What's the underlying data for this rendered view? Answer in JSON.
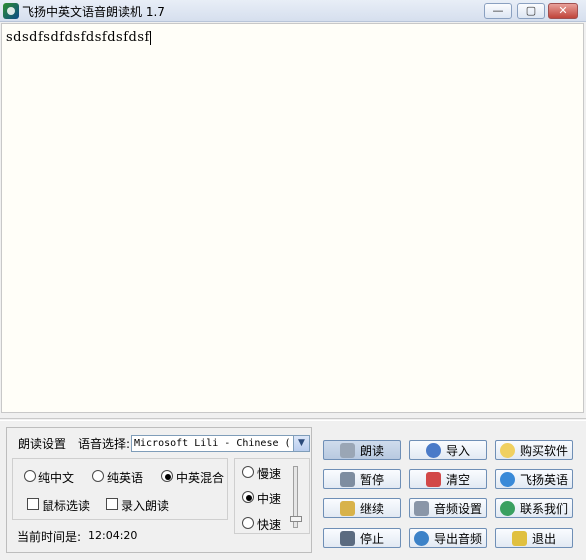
{
  "window": {
    "title": "飞扬中英文语音朗读机 1.7",
    "controls": {
      "minimize": "—",
      "maximize": "▢",
      "close": "✕"
    }
  },
  "editor": {
    "text": "sdsdfsdfdsfdsfdsfdsf"
  },
  "settings": {
    "reading_settings_label": "朗读设置",
    "voice_label": "语音选择:",
    "voice_value": "Microsoft Lili - Chinese (",
    "modes": [
      {
        "label": "纯中文",
        "selected": false
      },
      {
        "label": "纯英语",
        "selected": false
      },
      {
        "label": "中英混合",
        "selected": true
      }
    ],
    "options": [
      {
        "label": "鼠标选读",
        "checked": false
      },
      {
        "label": "录入朗读",
        "checked": false
      }
    ],
    "speeds": [
      {
        "label": "慢速",
        "selected": false
      },
      {
        "label": "中速",
        "selected": true
      },
      {
        "label": "快速",
        "selected": false
      }
    ],
    "speed_level": 0.1,
    "time_label": "当前时间是:",
    "time_value": "12:04:20"
  },
  "buttons": {
    "read": "朗读",
    "import": "导入",
    "buy": "购买软件",
    "pause": "暂停",
    "clear": "清空",
    "feiyang_english": "飞扬英语",
    "continue": "继续",
    "audio_settings": "音频设置",
    "contact_us": "联系我们",
    "stop": "停止",
    "export_audio": "导出音频",
    "exit": "退出"
  },
  "icons": [
    "speaker-icon",
    "import-icon",
    "bulb-icon",
    "keyboard-icon",
    "clear-icon",
    "ie-icon",
    "continue-icon",
    "settings-icon",
    "globe-icon",
    "stop-icon",
    "search-icon",
    "pencil-icon"
  ]
}
